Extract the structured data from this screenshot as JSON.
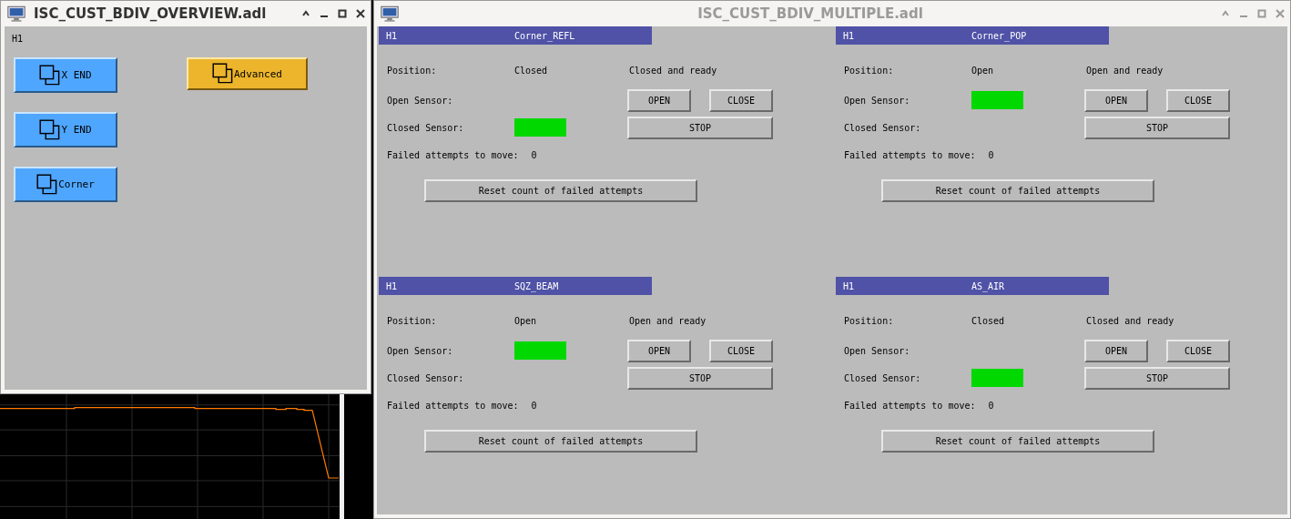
{
  "overview_window": {
    "title": "ISC_CUST_BDIV_OVERVIEW.adl",
    "active": true,
    "site_label": "H1",
    "buttons": [
      {
        "label": "X END",
        "color": "#4fa6ff"
      },
      {
        "label": "Advanced",
        "color": "#ecb52c"
      },
      {
        "label": "Y END",
        "color": "#4fa6ff"
      },
      {
        "label": "Corner",
        "color": "#4fa6ff"
      }
    ]
  },
  "multiple_window": {
    "title": "ISC_CUST_BDIV_MULTIPLE.adl",
    "active": false,
    "panels": [
      {
        "site": "H1",
        "name": "Corner_REFL",
        "position_label": "Position:",
        "position": "Closed",
        "status": "Closed and ready",
        "open_sensor_label": "Open Sensor:",
        "open_sensor_on": false,
        "closed_sensor_label": "Closed Sensor:",
        "closed_sensor_on": true,
        "failed_label": "Failed attempts to move:",
        "failed_count": "0",
        "open_button": "OPEN",
        "close_button": "CLOSE",
        "stop_button": "STOP",
        "reset_button": "Reset count of failed attempts"
      },
      {
        "site": "H1",
        "name": "Corner_POP",
        "position_label": "Position:",
        "position": "Open",
        "status": "Open and ready",
        "open_sensor_label": "Open Sensor:",
        "open_sensor_on": true,
        "closed_sensor_label": "Closed Sensor:",
        "closed_sensor_on": false,
        "failed_label": "Failed attempts to move:",
        "failed_count": "0",
        "open_button": "OPEN",
        "close_button": "CLOSE",
        "stop_button": "STOP",
        "reset_button": "Reset count of failed attempts"
      },
      {
        "site": "H1",
        "name": "SQZ_BEAM",
        "position_label": "Position:",
        "position": "Open",
        "status": "Open and ready",
        "open_sensor_label": "Open Sensor:",
        "open_sensor_on": true,
        "closed_sensor_label": "Closed Sensor:",
        "closed_sensor_on": false,
        "failed_label": "Failed attempts to move:",
        "failed_count": "0",
        "open_button": "OPEN",
        "close_button": "CLOSE",
        "stop_button": "STOP",
        "reset_button": "Reset count of failed attempts"
      },
      {
        "site": "H1",
        "name": "AS_AIR",
        "position_label": "Position:",
        "position": "Closed",
        "status": "Closed and ready",
        "open_sensor_label": "Open Sensor:",
        "open_sensor_on": false,
        "closed_sensor_label": "Closed Sensor:",
        "closed_sensor_on": true,
        "failed_label": "Failed attempts to move:",
        "failed_count": "0",
        "open_button": "OPEN",
        "close_button": "CLOSE",
        "stop_button": "STOP",
        "reset_button": "Reset count of failed attempts"
      }
    ]
  }
}
